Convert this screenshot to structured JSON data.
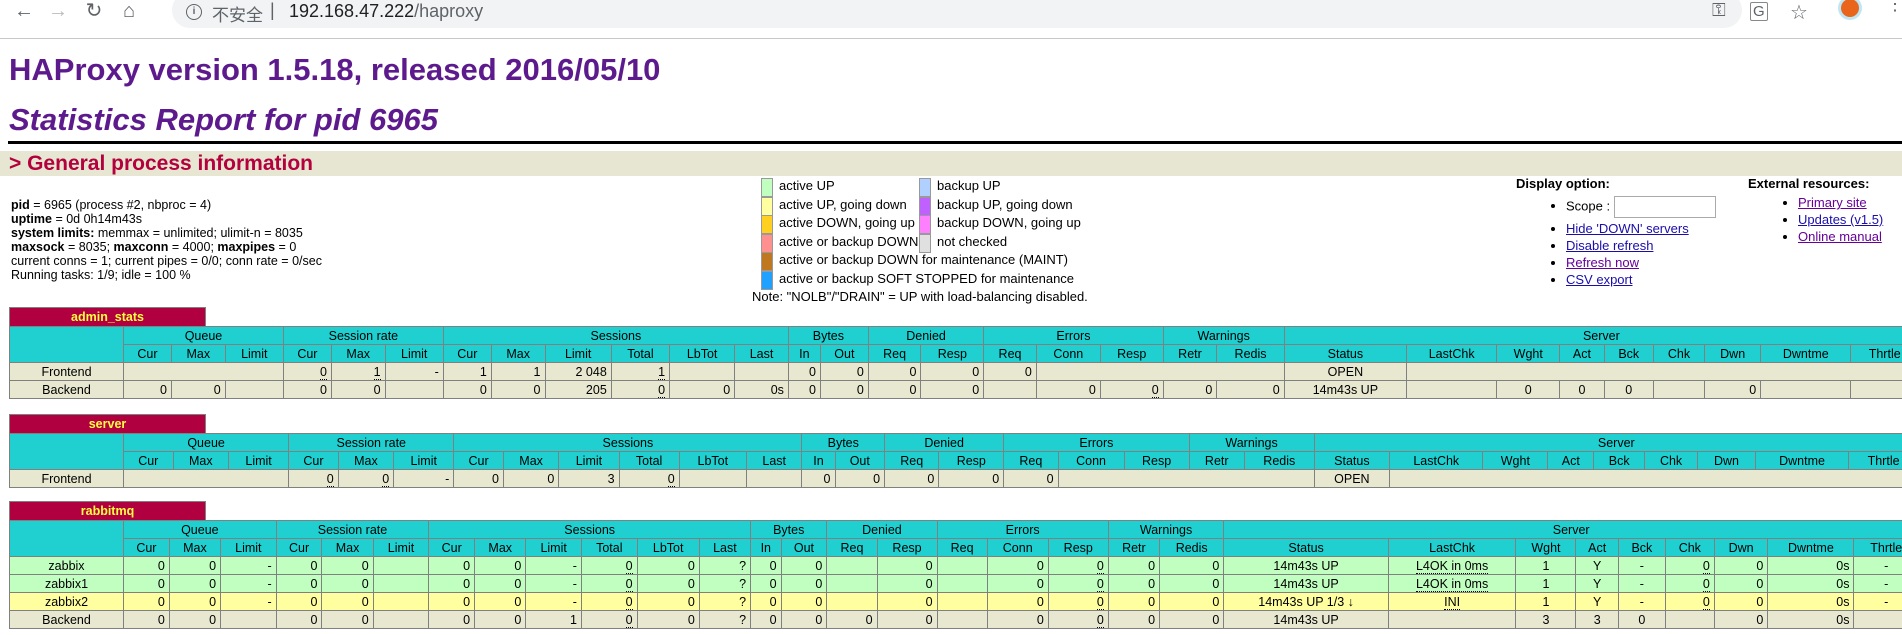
{
  "browser": {
    "insecure_label": "不安全",
    "url_host": "192.168.47.222",
    "url_path": "/haproxy"
  },
  "header": {
    "title": "HAProxy version 1.5.18, released 2016/05/10",
    "subtitle": "Statistics Report for pid 6965",
    "section": "> General process information"
  },
  "process": {
    "pid_label": "pid",
    "pid_value": " = 6965 (process #2, nbproc = 4)",
    "uptime_label": "uptime",
    "uptime_value": " = 0d 0h14m43s",
    "limits_label": "system limits:",
    "limits_value": " memmax = unlimited; ulimit-n = 8035",
    "maxsock_label": "maxsock",
    "maxsock_value": " = 8035; ",
    "maxconn_label": "maxconn",
    "maxconn_value": " = 4000; ",
    "maxpipes_label": "maxpipes",
    "maxpipes_value": " = 0",
    "conns": "current conns = 1; current pipes = 0/0; conn rate = 0/sec",
    "tasks": "Running tasks: 1/9; idle = 100 %"
  },
  "legend": {
    "col1": [
      {
        "label": "active UP",
        "color": "#c0ffc0"
      },
      {
        "label": "active UP, going down",
        "color": "#ffffa0"
      },
      {
        "label": "active DOWN, going up",
        "color": "#ffd020"
      },
      {
        "label": "active or backup DOWN",
        "color": "#ff9090"
      }
    ],
    "col2": [
      {
        "label": "backup UP",
        "color": "#b0d0ff"
      },
      {
        "label": "backup UP, going down",
        "color": "#c060ff"
      },
      {
        "label": "backup DOWN, going up",
        "color": "#ff80ff"
      },
      {
        "label": "not checked",
        "color": "#e0e0e0"
      }
    ],
    "wide": [
      {
        "label": "active or backup DOWN for maintenance (MAINT)",
        "color": "#c07820"
      },
      {
        "label": "active or backup SOFT STOPPED for maintenance",
        "color": "#20a0ff"
      }
    ],
    "note": "Note: \"NOLB\"/\"DRAIN\" = UP with load-balancing disabled."
  },
  "display_options": {
    "title": "Display option:",
    "scope_label": "Scope :",
    "scope_value": "",
    "links": [
      "Hide 'DOWN' servers",
      "Disable refresh",
      "Refresh now",
      "CSV export"
    ]
  },
  "external_resources": {
    "title": "External resources:",
    "links": [
      "Primary site",
      "Updates (v1.5)",
      "Online manual"
    ]
  },
  "table_headers": {
    "groups": [
      "Queue",
      "Session rate",
      "Sessions",
      "Bytes",
      "Denied",
      "Errors",
      "Warnings",
      "Server"
    ],
    "columns": [
      "Cur",
      "Max",
      "Limit",
      "Cur",
      "Max",
      "Limit",
      "Cur",
      "Max",
      "Limit",
      "Total",
      "LbTot",
      "Last",
      "In",
      "Out",
      "Req",
      "Resp",
      "Req",
      "Conn",
      "Resp",
      "Retr",
      "Redis",
      "Status",
      "LastChk",
      "Wght",
      "Act",
      "Bck",
      "Chk",
      "Dwn",
      "Dwntme",
      "Thrtle"
    ]
  },
  "proxies": [
    {
      "name": "admin_stats",
      "rows": [
        {
          "name": "Frontend",
          "type": "frontend",
          "cells": [
            "",
            "",
            "",
            "0",
            "1",
            "-",
            "1",
            "1",
            "2 048",
            "1",
            "",
            "",
            "0",
            "0",
            "0",
            "0",
            "0",
            "",
            "",
            "",
            "",
            "OPEN",
            "",
            "",
            "",
            "",
            "",
            "",
            "",
            ""
          ]
        },
        {
          "name": "Backend",
          "type": "backend",
          "cells": [
            "0",
            "0",
            "",
            "0",
            "0",
            "",
            "0",
            "0",
            "205",
            "0",
            "0",
            "0s",
            "0",
            "0",
            "0",
            "0",
            "",
            "0",
            "0",
            "0",
            "0",
            "14m43s UP",
            "",
            "0",
            "0",
            "0",
            "",
            "0",
            "",
            ""
          ]
        }
      ]
    },
    {
      "name": "server",
      "rows": [
        {
          "name": "Frontend",
          "type": "frontend",
          "cells": [
            "",
            "",
            "",
            "0",
            "0",
            "-",
            "0",
            "0",
            "3",
            "0",
            "",
            "",
            "0",
            "0",
            "0",
            "0",
            "0",
            "",
            "",
            "",
            "",
            "OPEN",
            "",
            "",
            "",
            "",
            "",
            "",
            "",
            ""
          ]
        }
      ]
    },
    {
      "name": "rabbitmq",
      "rows": [
        {
          "name": "zabbix",
          "type": "active3",
          "cells": [
            "0",
            "0",
            "-",
            "0",
            "0",
            "",
            "0",
            "0",
            "-",
            "0",
            "0",
            "?",
            "0",
            "0",
            "",
            "0",
            "",
            "0",
            "0",
            "0",
            "0",
            "14m43s UP",
            "L4OK in 0ms",
            "1",
            "Y",
            "-",
            "0",
            "0",
            "0s",
            "-"
          ]
        },
        {
          "name": "zabbix1",
          "type": "active3",
          "cells": [
            "0",
            "0",
            "-",
            "0",
            "0",
            "",
            "0",
            "0",
            "-",
            "0",
            "0",
            "?",
            "0",
            "0",
            "",
            "0",
            "",
            "0",
            "0",
            "0",
            "0",
            "14m43s UP",
            "L4OK in 0ms",
            "1",
            "Y",
            "-",
            "0",
            "0",
            "0s",
            "-"
          ]
        },
        {
          "name": "zabbix2",
          "type": "active2",
          "cells": [
            "0",
            "0",
            "-",
            "0",
            "0",
            "",
            "0",
            "0",
            "-",
            "0",
            "0",
            "?",
            "0",
            "0",
            "",
            "0",
            "",
            "0",
            "0",
            "0",
            "0",
            "14m43s UP 1/3 ↓",
            "INI",
            "1",
            "Y",
            "-",
            "0",
            "0",
            "0s",
            "-"
          ]
        },
        {
          "name": "Backend",
          "type": "backend",
          "cells": [
            "0",
            "0",
            "",
            "0",
            "0",
            "",
            "0",
            "0",
            "1",
            "0",
            "0",
            "?",
            "0",
            "0",
            "0",
            "0",
            "",
            "0",
            "0",
            "0",
            "0",
            "14m43s UP",
            "",
            "3",
            "3",
            "0",
            "",
            "0",
            "0s",
            ""
          ]
        }
      ]
    }
  ]
}
